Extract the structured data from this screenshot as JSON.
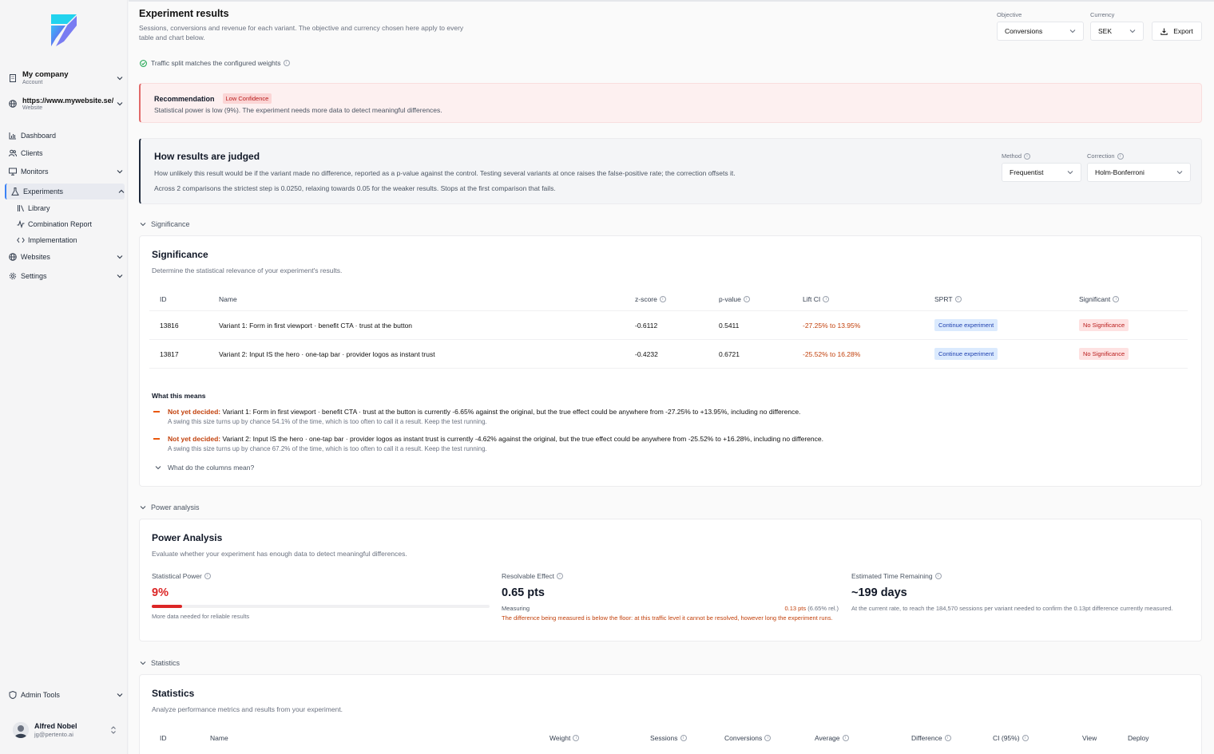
{
  "sidebar": {
    "account": {
      "name": "My company",
      "sub": "Account"
    },
    "website": {
      "name": "https://www.mywebsite.se/",
      "sub": "Website"
    },
    "nav": {
      "dashboard": "Dashboard",
      "clients": "Clients",
      "monitors": "Monitors",
      "experiments": "Experiments",
      "library": "Library",
      "combination": "Combination Report",
      "implementation": "Implementation",
      "websites": "Websites",
      "settings": "Settings",
      "admin": "Admin Tools"
    },
    "user": {
      "name": "Alfred Nobel",
      "email": "jg@pertento.ai"
    }
  },
  "header": {
    "title": "Experiment results",
    "description": "Sessions, conversions and revenue for each variant. The objective and currency chosen here apply to every table and chart below.",
    "objective_label": "Objective",
    "objective_value": "Conversions",
    "currency_label": "Currency",
    "currency_value": "SEK",
    "export_label": "Export",
    "traffic_note": "Traffic split matches the configured weights"
  },
  "recommendation": {
    "title": "Recommendation",
    "badge": "Low Confidence",
    "text": "Statistical power is low (9%). The experiment needs more data to detect meaningful differences."
  },
  "judged": {
    "title": "How results are judged",
    "text1": "How unlikely this result would be if the variant made no difference, reported as a p-value against the control. Testing several variants at once raises the false-positive rate; the correction offsets it.",
    "text2": "Across 2 comparisons the strictest step is 0.0250, relaxing towards 0.05 for the weaker results. Stops at the first comparison that fails.",
    "method_label": "Method",
    "method_value": "Frequentist",
    "correction_label": "Correction",
    "correction_value": "Holm-Bonferroni"
  },
  "significance": {
    "section_label": "Significance",
    "title": "Significance",
    "subtitle": "Determine the statistical relevance of your experiment's results.",
    "columns": {
      "id": "ID",
      "name": "Name",
      "z": "z-score",
      "p": "p-value",
      "lift": "Lift CI",
      "sprt": "SPRT",
      "sig": "Significant"
    },
    "rows": [
      {
        "id": "13816",
        "name": "Variant 1: Form in first viewport · benefit CTA · trust at the button",
        "z": "-0.6112",
        "p": "0.5411",
        "lift": "-27.25% to 13.95%",
        "sprt": "Continue experiment",
        "sig": "No Significance"
      },
      {
        "id": "13817",
        "name": "Variant 2: Input IS the hero · one-tap bar · provider logos as instant trust",
        "z": "-0.4232",
        "p": "0.6721",
        "lift": "-25.52% to 16.28%",
        "sprt": "Continue experiment",
        "sig": "No Significance"
      }
    ],
    "means_title": "What this means",
    "means": [
      {
        "tag": "Not yet decided:",
        "text": "Variant 1: Form in first viewport · benefit CTA · trust at the button is currently -6.65% against the original, but the true effect could be anywhere from -27.25% to +13.95%, including no difference.",
        "sub": "A swing this size turns up by chance 54.1% of the time, which is too often to call it a result. Keep the test running."
      },
      {
        "tag": "Not yet decided:",
        "text": "Variant 2: Input IS the hero · one-tap bar · provider logos as instant trust is currently -4.62% against the original, but the true effect could be anywhere from -25.52% to +16.28%, including no difference.",
        "sub": "A swing this size turns up by chance 67.2% of the time, which is too often to call it a result. Keep the test running."
      }
    ],
    "columns_toggle": "What do the columns mean?"
  },
  "power": {
    "section_label": "Power analysis",
    "title": "Power Analysis",
    "subtitle": "Evaluate whether your experiment has enough data to detect meaningful differences.",
    "stat_label": "Statistical Power",
    "stat_value": "9%",
    "stat_fraction": 0.09,
    "stat_note": "More data needed for reliable results",
    "resolvable_label": "Resolvable Effect",
    "resolvable_value": "0.65 pts",
    "measuring_label": "Measuring",
    "measuring_value": "0.13 pts",
    "measuring_rel": "(6.65% rel.)",
    "measuring_note": "The difference being measured is below the floor: at this traffic level it cannot be resolved, however long the experiment runs.",
    "time_label": "Estimated Time Remaining",
    "time_value": "~199 days",
    "time_note": "At the current rate, to reach the 184,570 sessions per variant needed to confirm the 0.13pt difference currently measured."
  },
  "statistics": {
    "section_label": "Statistics",
    "title": "Statistics",
    "subtitle": "Analyze performance metrics and results from your experiment.",
    "columns": {
      "id": "ID",
      "name": "Name",
      "weight": "Weight",
      "sessions": "Sessions",
      "conversions": "Conversions",
      "average": "Average",
      "difference": "Difference",
      "ci": "CI (95%)",
      "view": "View",
      "deploy": "Deploy"
    }
  },
  "colors": {
    "accent": "#3b82f6",
    "danger": "#dc2626",
    "warning": "#c2410c",
    "success": "#16a34a"
  }
}
